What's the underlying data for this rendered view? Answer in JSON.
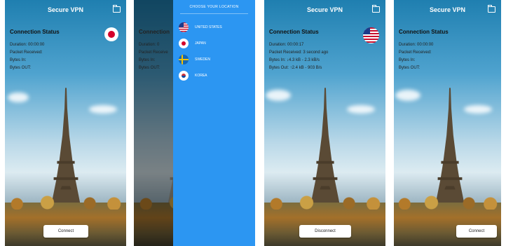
{
  "screens": [
    {
      "title": "Secure VPN",
      "status_title": "Connection Status",
      "stats": [
        "Duration: 00:00:00",
        "Packet Received:",
        "Bytes In:",
        "Bytes OUT:"
      ],
      "flag": "japan-flag-icon",
      "button": "Connect"
    },
    {
      "drawer_title": "CHOOSE YOUR LOCATION",
      "locations": [
        {
          "label": "UNITED STATES",
          "icon": "us-flag-icon"
        },
        {
          "label": "JAPAN",
          "icon": "japan-flag-icon"
        },
        {
          "label": "SWEDEN",
          "icon": "sweden-flag-icon"
        },
        {
          "label": "KOREA",
          "icon": "korea-flag-icon"
        }
      ],
      "behind_title": "Connection",
      "behind_stats": [
        "Duration: 0",
        "Packet Receive",
        "Bytes In:",
        "Bytes OUT:"
      ]
    },
    {
      "title": "Secure VPN",
      "status_title": "Connection Status",
      "stats": [
        "Duration: 00:00:17",
        "Packet Received: 3 second ago",
        "Bytes In: ↓4.3 kB - 2.3 kB/s",
        "Bytes Out: ↑2.4 kB - 903 B/s"
      ],
      "flag": "us-flag-icon",
      "button": "Disconnect"
    },
    {
      "title": "Secure VPN",
      "status_title": "Connection Status",
      "stats": [
        "Duration: 00:00:00",
        "Packet Received:",
        "Bytes In:",
        "Bytes OUT:"
      ],
      "button": "Connect"
    }
  ],
  "icons": {
    "folder": "folder-icon",
    "tower": "eiffel-tower-image"
  },
  "colors": {
    "drawer": "#2c96f2",
    "japan_red": "#d4002a",
    "us_blue": "#1d3a8a"
  }
}
